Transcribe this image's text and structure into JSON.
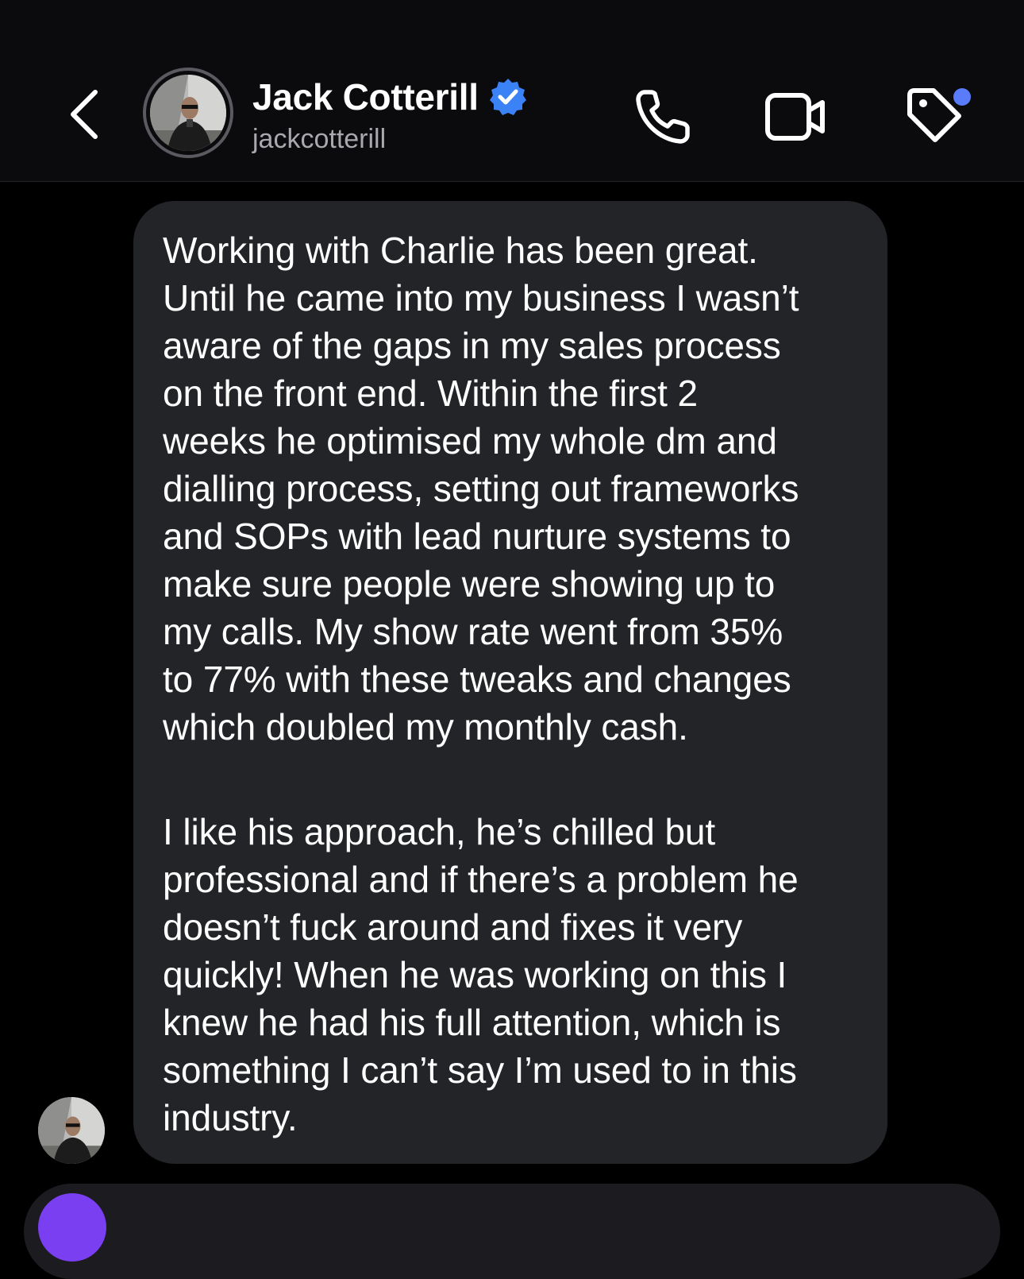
{
  "header": {
    "contact_name": "Jack Cotterill",
    "username": "jackcotterill",
    "verified": true,
    "verified_color": "#3b82f6",
    "notification_dot_color": "#5b7cfa",
    "icons": {
      "back": "chevron-left-icon",
      "call": "phone-icon",
      "video": "video-camera-icon",
      "tag": "tag-icon"
    }
  },
  "message": {
    "paragraphs": [
      "Working with Charlie has been great.\nUntil he came into my business I wasn’t\naware of the gaps in my sales process\non the front end. Within the first 2\nweeks he optimised my whole dm and\ndialling process, setting out frameworks\nand SOPs with lead nurture systems to\nmake sure people were showing up to\nmy calls. My show rate went from 35%\nto 77% with these tweaks and changes\nwhich doubled my monthly cash.",
      "I like his approach, he’s chilled but\nprofessional and if there’s a problem he\ndoesn’t fuck around and fixes it very\nquickly! When he was working on this I\nknew he had his full attention, which is\nsomething I can’t say I’m used to in this\nindustry."
    ]
  },
  "colors": {
    "background": "#000000",
    "header_background": "#0b0b0d",
    "bubble_background": "#232428",
    "composer_accent": "#7b3ff2"
  }
}
